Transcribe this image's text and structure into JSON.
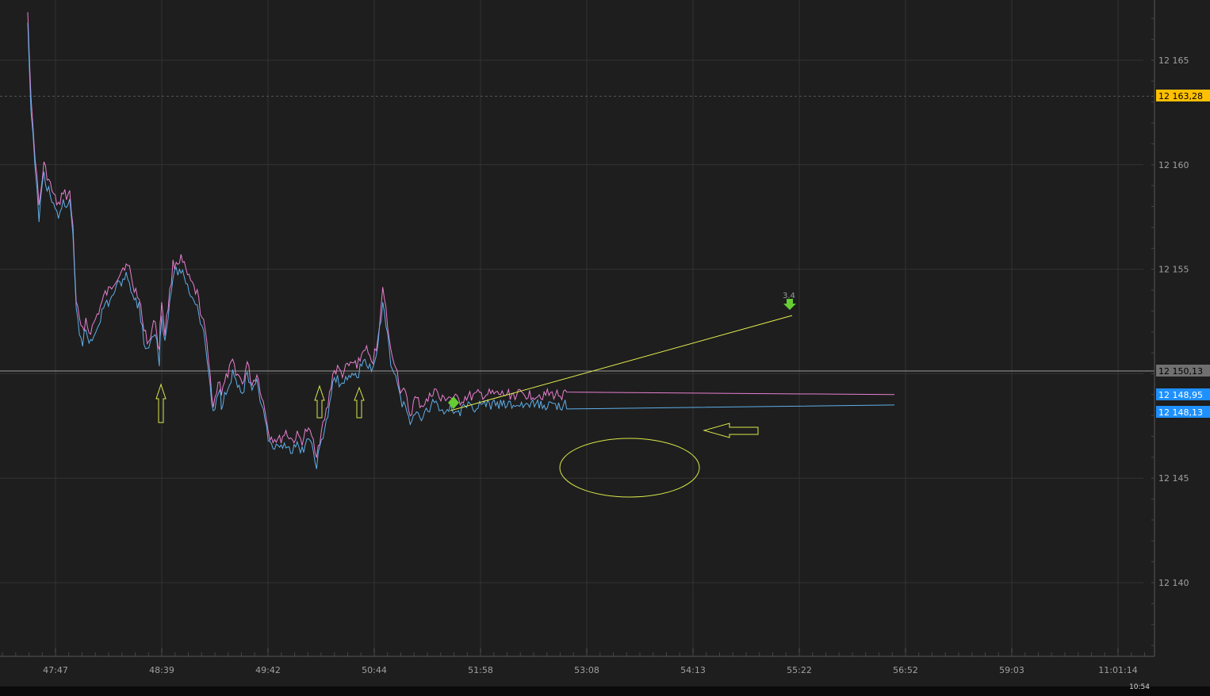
{
  "chart_data": {
    "type": "line",
    "title": "",
    "xlabel": "",
    "ylabel": "",
    "ylim": [
      12136.6,
      12167.3
    ],
    "grid": true,
    "x_ticks": [
      "47:47",
      "48:39",
      "49:42",
      "50:44",
      "51:58",
      "53:08",
      "54:13",
      "55:22",
      "56:52",
      "59:03",
      "11:01:14"
    ],
    "y_ticks": [
      {
        "value": 12165,
        "label": "12 165"
      },
      {
        "value": 12160,
        "label": "12 160"
      },
      {
        "value": 12155,
        "label": "12 155"
      },
      {
        "value": 12145,
        "label": "12 145"
      },
      {
        "value": 12140,
        "label": "12 140"
      }
    ],
    "price_tags": [
      {
        "value": 12163.28,
        "label": "12 163,28",
        "bg": "#ffc000",
        "fg": "#000000"
      },
      {
        "value": 12150.13,
        "label": "12 150,13",
        "bg": "#707070",
        "fg": "#000000"
      },
      {
        "value": 12148.95,
        "label": "12 148,95",
        "bg": "#1e90ff",
        "fg": "#ffffff"
      },
      {
        "value": 12148.13,
        "label": "12 148,13",
        "bg": "#1e90ff",
        "fg": "#ffffff"
      }
    ],
    "horizontal_line": 12150.13,
    "dashed_line": 12163.28,
    "series": [
      {
        "color": "#e87fd0",
        "x": [
          0,
          0.2,
          0.45,
          0.7,
          1,
          1.4,
          1.6,
          1.8,
          2.0,
          2.2,
          2.4,
          2.6,
          2.8,
          3.0,
          3.2,
          3.4,
          3.6,
          3.8,
          4.0,
          4.4,
          4.8,
          5.1,
          5.4,
          5.7,
          6.0,
          6.3,
          6.6,
          6.9,
          7.2,
          7.5,
          7.8,
          8.0,
          8.15,
          8.2,
          8.3,
          8.5,
          8.7,
          9.0,
          9.5,
          10.0,
          10.5,
          11.0,
          11.5,
          11.9,
          12.0,
          12.2,
          12.4,
          12.7,
          13.0,
          13.3,
          13.6,
          13.9,
          14.2,
          14.5,
          14.8,
          15.0,
          15.6,
          16.0,
          16.4,
          16.7,
          17.0,
          17.3,
          17.6,
          17.9,
          18.2,
          18.6,
          18.9,
          19.2,
          19.5,
          19.8,
          20.2,
          20.5,
          20.9,
          21.3,
          21.6,
          21.8,
          22.0,
          22.2,
          22.5,
          22.8,
          23.1,
          23.4,
          23.7,
          24.0,
          24.4,
          24.8,
          25.2,
          25.4,
          25.6,
          26.0,
          26.4,
          26.8,
          27.2,
          27.6,
          28.0,
          28.4,
          28.8,
          29.1,
          29.3,
          29.6,
          30.0,
          30.3,
          30.6,
          31.0,
          31.5,
          32.0,
          32.5,
          33.0,
          33.5
        ],
        "y": [
          12167.3,
          12163,
          12160.5,
          12158,
          12160,
          12159,
          12158.5,
          12158.2,
          12158.0,
          12158.8,
          12158.5,
          12158.6,
          12157.0,
          12153.5,
          12152.5,
          12152.0,
          12152.6,
          12152.0,
          12152.2,
          12153.0,
          12153.8,
          12154.0,
          12154.5,
          12154.8,
          12155.2,
          12155.0,
          12154.0,
          12153.8,
          12152.0,
          12151.5,
          12152.5,
          12152.0,
          12151.0,
          12152.2,
          12153.5,
          12152.0,
          12153.2,
          12155.2,
          12155.5,
          12154.5,
          12153.8,
          12152.0,
          12148.5,
          12149.8,
          12149.0,
          12149.5,
          12150.0,
          12150.5,
          12150.0,
          12149.5,
          12150.5,
          12149.5,
          12150.0,
          12149.0,
          12147.8,
          12147.0,
          12146.8,
          12147.2,
          12146.8,
          12147.0,
          12146.8,
          12147.3,
          12147.0,
          12146.2,
          12147.2,
          12148.5,
          12150.0,
          12150.2,
          12150.0,
          12150.3,
          12150.5,
          12150.5,
          12151.3,
          12150.5,
          12151.2,
          12152.5,
          12154.0,
          12153.0,
          12151.0,
          12150.5,
          12149.2,
          12149.0,
          12148.0,
          12148.8,
          12148.5,
          12148.7,
          12149.3,
          12149.0,
          12148.7,
          12148.9,
          12148.8,
          12148.7,
          12148.9,
          12148.9,
          12149.0,
          12149.0,
          12149.0,
          12149.0,
          12149.0,
          12149.0,
          12149.0,
          12149.0,
          12149.0,
          12149.0,
          12149.0,
          12149.0,
          12149.0,
          12149.0,
          12149.0
        ]
      },
      {
        "color": "#5eaee8",
        "x": [
          0,
          0.2,
          0.45,
          0.7,
          1,
          1.4,
          1.6,
          1.8,
          2.0,
          2.2,
          2.4,
          2.6,
          2.8,
          3.0,
          3.2,
          3.4,
          3.6,
          3.8,
          4.0,
          4.4,
          4.8,
          5.1,
          5.4,
          5.7,
          6.0,
          6.3,
          6.6,
          6.9,
          7.2,
          7.5,
          7.8,
          8.0,
          8.15,
          8.2,
          8.3,
          8.5,
          8.7,
          9.0,
          9.5,
          10.0,
          10.5,
          11.0,
          11.5,
          11.9,
          12.0,
          12.2,
          12.4,
          12.7,
          13.0,
          13.3,
          13.6,
          13.9,
          14.2,
          14.5,
          14.8,
          15.0,
          15.6,
          16.0,
          16.4,
          16.7,
          17.0,
          17.3,
          17.6,
          17.9,
          18.2,
          18.6,
          18.9,
          19.2,
          19.5,
          19.8,
          20.2,
          20.5,
          20.9,
          21.3,
          21.6,
          21.8,
          22.0,
          22.2,
          22.5,
          22.8,
          23.1,
          23.4,
          23.7,
          24.0,
          24.4,
          24.8,
          25.2,
          25.4,
          25.6,
          26.0,
          26.4,
          26.8,
          27.2,
          27.6,
          28.0,
          28.4,
          28.8,
          29.1,
          29.3,
          29.6,
          30.0,
          30.3,
          30.6,
          31.0,
          31.5,
          32.0,
          32.5,
          33.0,
          33.5
        ],
        "y": [
          12166.8,
          12162.5,
          12160.0,
          12157.5,
          12159.5,
          12158.5,
          12158.0,
          12157.7,
          12157.5,
          12158.3,
          12158.0,
          12158.1,
          12156.5,
          12153.0,
          12152.0,
          12151.5,
          12152.1,
          12151.5,
          12151.7,
          12152.5,
          12153.3,
          12153.5,
          12154.0,
          12154.3,
          12154.7,
          12154.5,
          12153.5,
          12153.3,
          12151.5,
          12151.0,
          12152.0,
          12151.5,
          12150.5,
          12151.7,
          12153.0,
          12151.5,
          12152.7,
          12154.7,
          12155.0,
          12154.0,
          12153.3,
          12151.5,
          12148.0,
          12149.3,
          12148.5,
          12149.0,
          12149.5,
          12150.0,
          12149.5,
          12149.0,
          12150.0,
          12149.0,
          12149.5,
          12148.5,
          12147.3,
          12146.5,
          12146.3,
          12146.7,
          12146.3,
          12146.5,
          12146.3,
          12146.8,
          12146.5,
          12145.7,
          12146.7,
          12148.0,
          12149.5,
          12149.7,
          12149.5,
          12149.8,
          12150.0,
          12150.0,
          12150.8,
          12150.0,
          12150.7,
          12152.0,
          12153.5,
          12152.5,
          12150.5,
          12150.0,
          12148.7,
          12148.5,
          12147.5,
          12148.3,
          12148.0,
          12148.2,
          12148.8,
          12148.5,
          12148.2,
          12148.4,
          12148.3,
          12148.2,
          12148.4,
          12148.4,
          12148.5,
          12148.5,
          12148.5,
          12148.5,
          12148.5,
          12148.5,
          12148.5,
          12148.5,
          12148.5,
          12148.5,
          12148.5,
          12148.5,
          12148.5,
          12148.5,
          12148.5
        ]
      }
    ],
    "annotation_label": "3.4"
  },
  "taskbar": {
    "clock": "10:54"
  }
}
